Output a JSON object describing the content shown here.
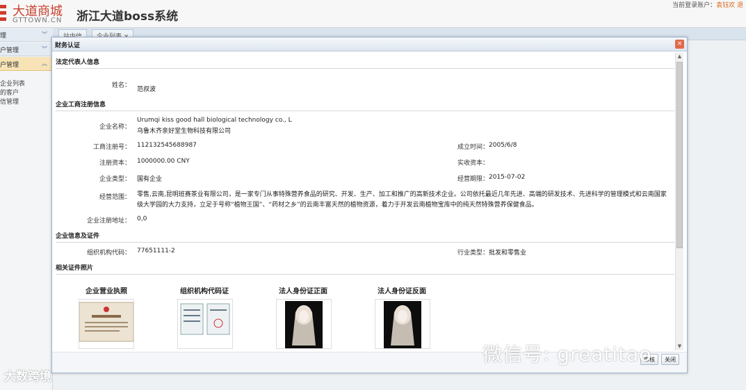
{
  "header": {
    "logo_cn": "大道商城",
    "logo_en": "GTTOWN.CN",
    "system_title": "浙江大道boss系统",
    "login_prefix": "当前登录账户：",
    "login_user": "袁钰欢 退"
  },
  "tabs": [
    "站内信",
    "企业列表"
  ],
  "tab_close": "×",
  "sidebar": {
    "groups": [
      "理",
      "户管理",
      "户管理"
    ],
    "items": [
      "企业列表",
      "的客户",
      "信管理"
    ]
  },
  "watermarks": {
    "left": "大数跨境",
    "right": "微信号: greatitao"
  },
  "modal": {
    "title": "财务认证",
    "close": "×",
    "sections": {
      "legal": "法定代表人信息",
      "registration": "企业工商注册信息",
      "certs_info": "企业信息及证件",
      "photos": "相关证件照片"
    },
    "legal_name_label": "姓名：",
    "legal_name": "范叔波",
    "company_name_label": "企业名称：",
    "company_name_en": "Urumqi kiss good hall biological technology co., L",
    "company_name_cn": "乌鲁木齐亲好堂生物科技有限公司",
    "reg_no_label": "工商注册号：",
    "reg_no": "112132545688987",
    "found_label": "成立时间：",
    "found": "2005/6/8",
    "capital_label": "注册资本：",
    "capital": "1000000.00 CNY",
    "paid_label": "实收资本：",
    "paid": "",
    "type_label": "企业类型：",
    "type": "国有企业",
    "term_label": "经营期限：",
    "term": "2015-07-02",
    "scope_label": "经营范围：",
    "scope": "零售,云南,昆明班赛茶业有限公司，是一家专门从事特殊营养食品的研究、开发、生产、加工和推广的高新技术企业。公司依托最近几年先进、高端的研发技术、先进科学的管理模式和云南国家级大学园的大力支持，立足于号称“植物王国”、“药材之乡”的云南丰富天然的植物资源，着力于开发云南植物宝库中的纯天然特殊营养保健食品。",
    "address_label": "企业注册地址：",
    "address": "0,0",
    "org_code_label": "组织机构代码：",
    "org_code": "77651111-2",
    "industry_label": "行业类型：",
    "industry": "批发和零售业",
    "certs": [
      "企业营业执照",
      "组织机构代码证",
      "法人身份证正面",
      "法人身份证反面"
    ],
    "buttons": {
      "approve": "审核",
      "close": "关闭"
    }
  },
  "colors": {
    "accent": "#d23a2a",
    "modal_border": "#9fb3cb",
    "sidebar_active": "#f7e3b5"
  }
}
